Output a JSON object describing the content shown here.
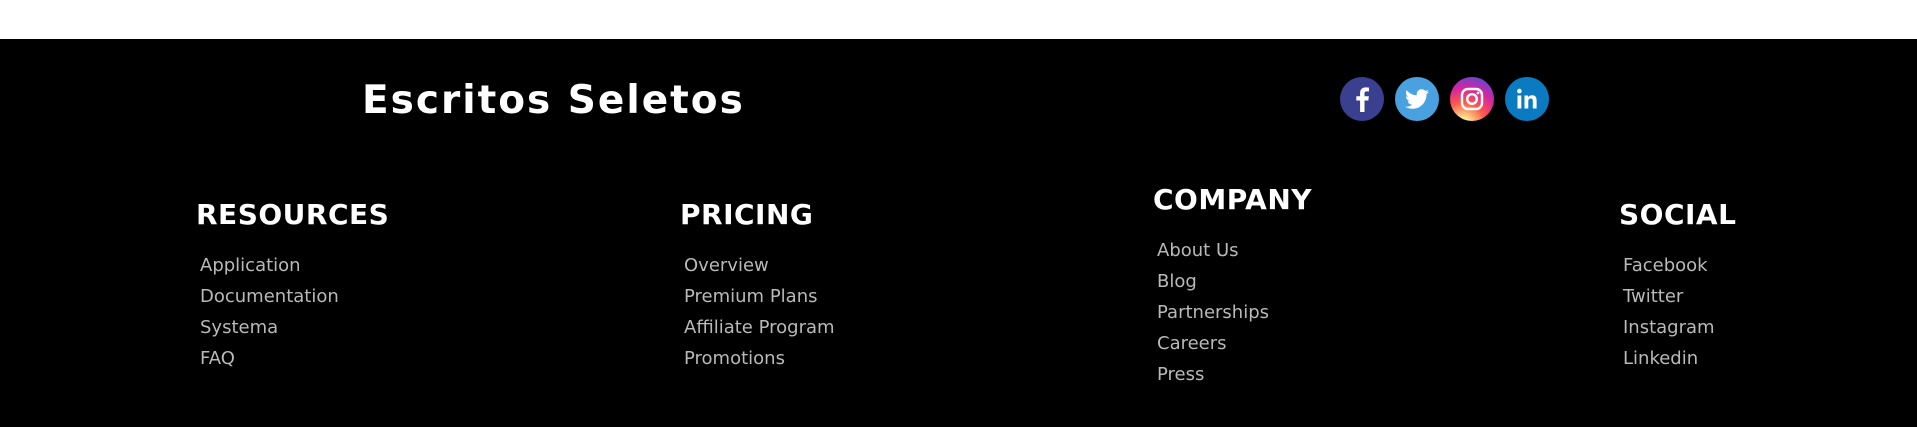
{
  "brand": {
    "title": "Escritos Seletos"
  },
  "social_icons": [
    {
      "name": "facebook-icon",
      "label": "f",
      "color": "#3b3f8f"
    },
    {
      "name": "twitter-icon",
      "label": "twitter",
      "color": "#4aa1e0"
    },
    {
      "name": "instagram-icon",
      "label": "instagram",
      "color": "#d6249f"
    },
    {
      "name": "linkedin-icon",
      "label": "in",
      "color": "#0a7bc1"
    }
  ],
  "columns": {
    "resources": {
      "title": "RESOURCES",
      "items": [
        "Application",
        "Documentation",
        "Systema",
        "FAQ"
      ]
    },
    "pricing": {
      "title": "PRICING",
      "items": [
        "Overview",
        "Premium Plans",
        "Affiliate Program",
        "Promotions"
      ]
    },
    "company": {
      "title": "COMPANY",
      "items": [
        "About Us",
        "Blog",
        "Partnerships",
        "Careers",
        "Press"
      ]
    },
    "social": {
      "title": "SOCIAL",
      "items": [
        "Facebook",
        "Twitter",
        "Instagram",
        "Linkedin"
      ]
    }
  },
  "colors": {
    "footer_background": "#000000",
    "heading": "#ffffff",
    "link": "#b9b9b9"
  }
}
